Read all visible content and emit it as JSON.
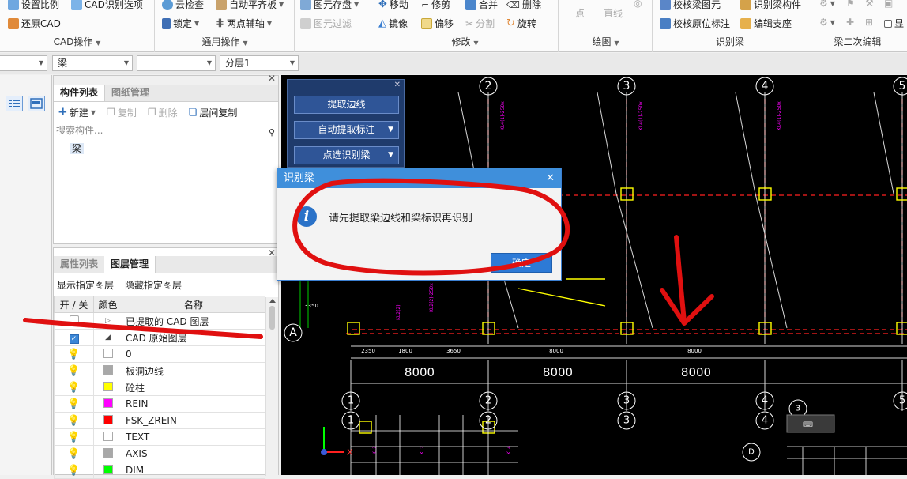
{
  "ribbon": {
    "cad_group": {
      "items": [
        "设置比例",
        "CAD识别选项",
        "还原CAD"
      ],
      "title": "CAD操作"
    },
    "general_group": {
      "items": [
        "云检查",
        "自动平齐板",
        "锁定",
        "两点辅轴"
      ],
      "title": "通用操作"
    },
    "element_group": {
      "items": [
        "图元存盘",
        "图元过滤"
      ]
    },
    "modify_group": {
      "items": [
        "移动",
        "修剪",
        "合并",
        "删除",
        "镜像",
        "偏移",
        "分割",
        "旋转"
      ],
      "title": "修改"
    },
    "draw_group": {
      "items": [
        "点",
        "直线"
      ],
      "title": "绘图"
    },
    "identify_group": {
      "items": [
        "校核梁图元",
        "识别梁构件",
        "校核原位标注",
        "编辑支座"
      ],
      "title": "识别梁"
    },
    "beam2_group": {
      "items": [
        "显"
      ],
      "title": "梁二次编辑"
    }
  },
  "combos": [
    "梁",
    "",
    "分层1"
  ],
  "component_panel": {
    "tabs": [
      "构件列表",
      "图纸管理"
    ],
    "toolbar": [
      "新建",
      "复制",
      "删除",
      "层间复制"
    ],
    "search_placeholder": "搜索构件...",
    "items": [
      "梁"
    ]
  },
  "layer_panel": {
    "tabs": [
      "属性列表",
      "图层管理"
    ],
    "actions": [
      "显示指定图层",
      "隐藏指定图层"
    ],
    "headers": [
      "开 / 关",
      "颜色",
      "名称"
    ],
    "groups": [
      {
        "name": "已提取的 CAD 图层",
        "checked": false,
        "expanded": false
      },
      {
        "name": "CAD 原始图层",
        "checked": true,
        "expanded": true
      }
    ],
    "layers": [
      {
        "name": "0",
        "color": "#ffffff"
      },
      {
        "name": "板洞边线",
        "color": "#a8a8a8"
      },
      {
        "name": "砼柱",
        "color": "#ffff00"
      },
      {
        "name": "REIN",
        "color": "#ff00ff"
      },
      {
        "name": "FSK_ZREIN",
        "color": "#ff0000"
      },
      {
        "name": "TEXT",
        "color": "#ffffff"
      },
      {
        "name": "AXIS",
        "color": "#a8a8a8"
      },
      {
        "name": "DIM",
        "color": "#00ff00"
      }
    ]
  },
  "float_panel": {
    "buttons": [
      "提取边线",
      "自动提取标注",
      "点选识别梁"
    ]
  },
  "dialog": {
    "title": "识别梁",
    "message": "请先提取梁边线和梁标识再识别",
    "ok_label": "确定"
  },
  "cad": {
    "top_axes": [
      "2",
      "3",
      "4",
      "5"
    ],
    "row_label": "A",
    "dims_small": [
      "2350",
      "1800",
      "3650",
      "8000",
      "8000"
    ],
    "dims_big": [
      "8000",
      "8000",
      "8000"
    ],
    "bottom_axes": [
      "1",
      "2",
      "3",
      "4",
      "5"
    ],
    "bottom_axes2": [
      "1",
      "2",
      "3",
      "4"
    ],
    "side_dim": "3350",
    "small_labels": [
      "3",
      "D"
    ]
  }
}
